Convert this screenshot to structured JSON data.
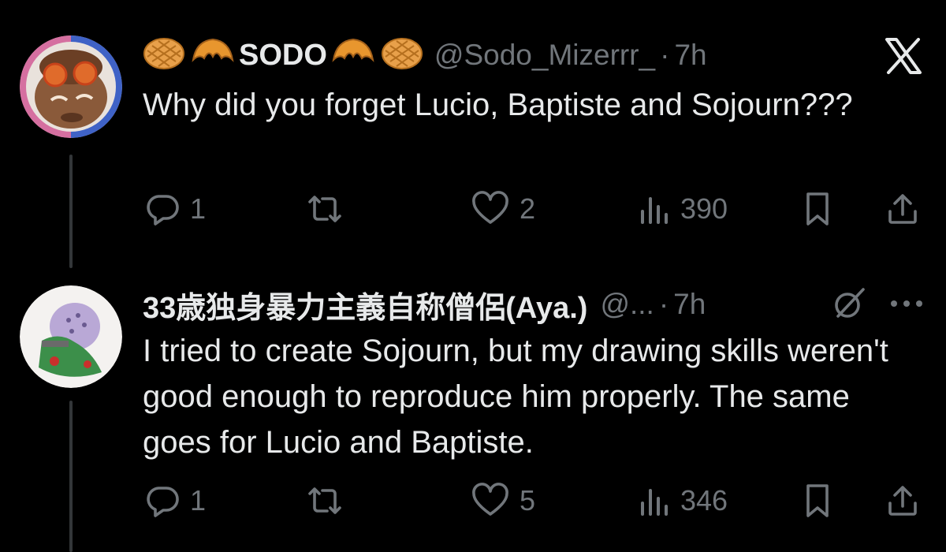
{
  "reply1": {
    "display_name": "SODO",
    "name_emojis": [
      "waffle-icon",
      "croissant-icon",
      "croissant-icon",
      "waffle-icon"
    ],
    "handle": "@Sodo_Mizerrr_",
    "separator": "·",
    "time": "7h",
    "text": "Why did you forget Lucio, Baptiste and Sojourn???",
    "actions": {
      "reply_count": "1",
      "retweet_count": "",
      "like_count": "2",
      "views_count": "390"
    }
  },
  "reply2": {
    "display_name": "33歳独身暴力主義自称僧侶(Aya.)",
    "handle": "@...",
    "separator": "·",
    "time": "7h",
    "text": "I tried to create Sojourn, but my drawing skills weren't good enough to reproduce him properly. The same goes for Lucio and Baptiste.",
    "actions": {
      "reply_count": "1",
      "retweet_count": "",
      "like_count": "5",
      "views_count": "346"
    }
  },
  "colors": {
    "background": "#000000",
    "primary_text": "#e7e9ea",
    "secondary_text": "#71767b",
    "thread_line": "#333639"
  }
}
